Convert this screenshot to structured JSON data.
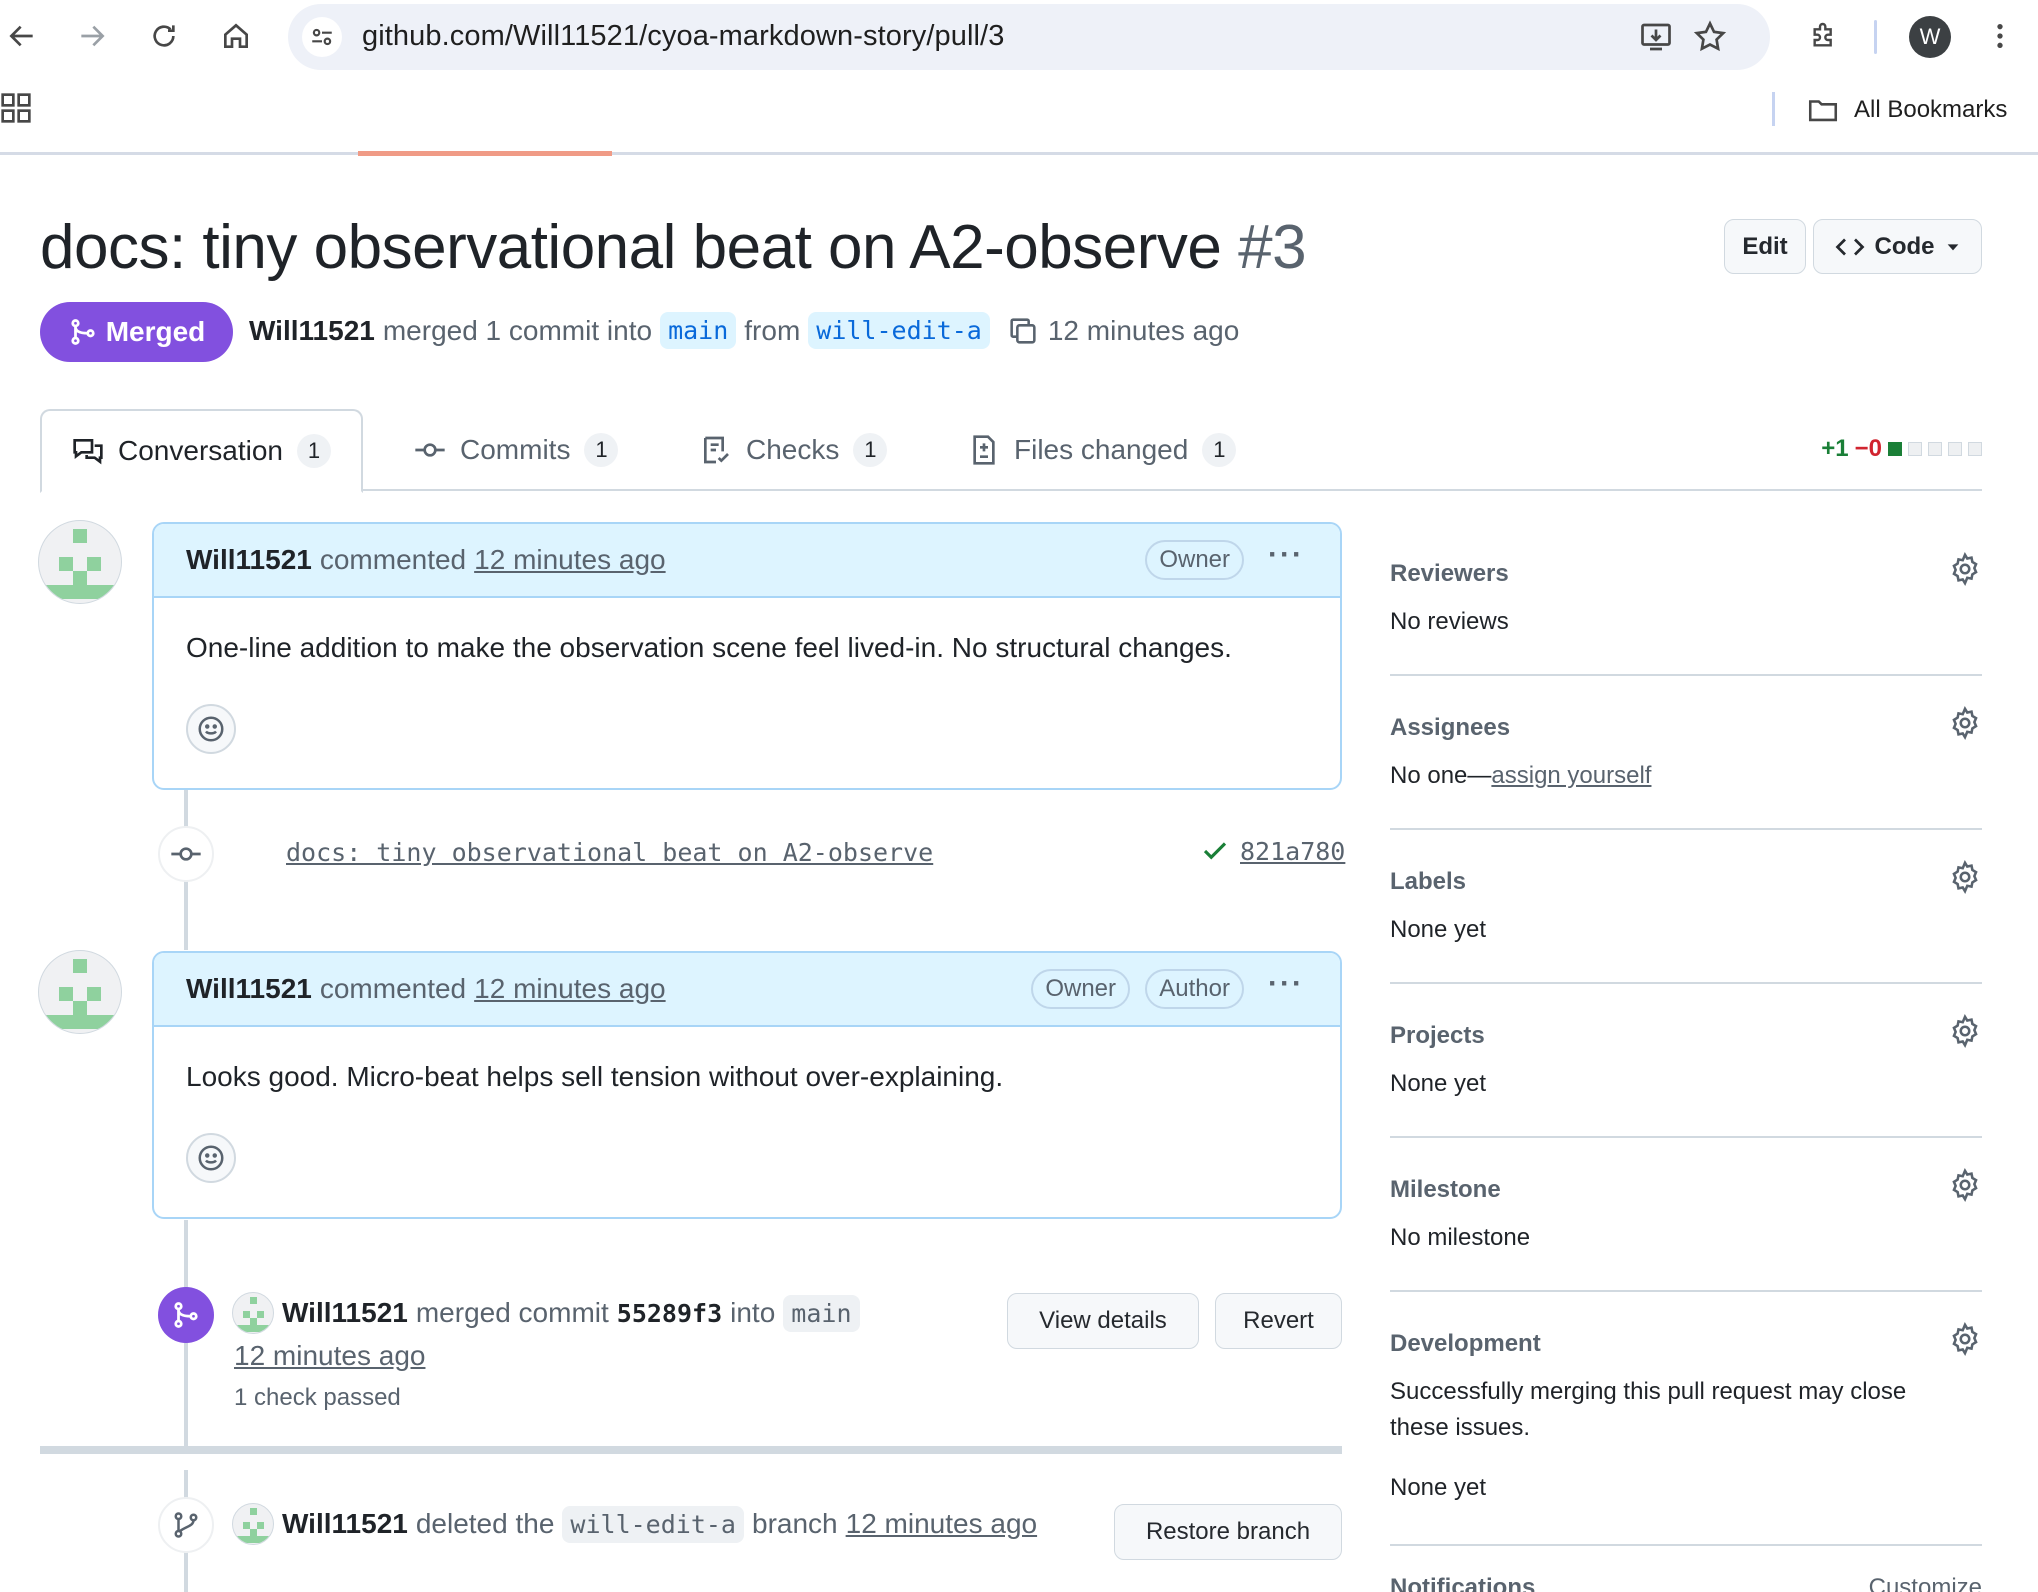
{
  "browser": {
    "url": "github.com/Will11521/cyoa-markdown-story/pull/3",
    "avatar_letter": "W",
    "bookmarks_label": "All Bookmarks"
  },
  "pr": {
    "title": "docs: tiny observational beat on A2-observe",
    "number": "#3",
    "state": "Merged",
    "author": "Will11521",
    "merged_text": "merged 1 commit into",
    "base_branch": "main",
    "from_text": "from",
    "head_branch": "will-edit-a",
    "time": "12 minutes ago",
    "edit_label": "Edit",
    "code_label": "Code"
  },
  "tabs": [
    {
      "label": "Conversation",
      "count": "1"
    },
    {
      "label": "Commits",
      "count": "1"
    },
    {
      "label": "Checks",
      "count": "1"
    },
    {
      "label": "Files changed",
      "count": "1"
    }
  ],
  "diffstat": {
    "additions": "+1",
    "deletions": "−0"
  },
  "timeline": {
    "comment1": {
      "author": "Will11521",
      "action": "commented",
      "time": "12 minutes ago",
      "role": "Owner",
      "body": "One-line addition to make the observation scene feel lived-in. No structural changes."
    },
    "commit": {
      "message": "docs: tiny observational beat on A2-observe",
      "sha": "821a780"
    },
    "comment2": {
      "author": "Will11521",
      "action": "commented",
      "time": "12 minutes ago",
      "role1": "Owner",
      "role2": "Author",
      "body": "Looks good. Micro-beat helps sell tension without over-explaining."
    },
    "merge": {
      "author": "Will11521",
      "text": "merged commit",
      "sha": "55289f3",
      "into": "into",
      "branch": "main",
      "time": "12 minutes ago",
      "checks": "1 check passed",
      "view_details": "View details",
      "revert": "Revert"
    },
    "deleted": {
      "author": "Will11521",
      "text": "deleted the",
      "branch": "will-edit-a",
      "text2": "branch",
      "time": "12 minutes ago",
      "restore": "Restore branch"
    }
  },
  "sidebar": {
    "reviewers": {
      "title": "Reviewers",
      "value": "No reviews"
    },
    "assignees": {
      "title": "Assignees",
      "value": "No one—",
      "link": "assign yourself"
    },
    "labels": {
      "title": "Labels",
      "value": "None yet"
    },
    "projects": {
      "title": "Projects",
      "value": "None yet"
    },
    "milestone": {
      "title": "Milestone",
      "value": "No milestone"
    },
    "development": {
      "title": "Development",
      "text": "Successfully merging this pull request may close these issues.",
      "value": "None yet"
    },
    "notifications": {
      "title": "Notifications",
      "customize": "Customize"
    }
  },
  "colors": {
    "merged": "#8250df",
    "accent_blue": "#0969da",
    "added": "#1a7f37",
    "deleted": "#d1242f"
  }
}
